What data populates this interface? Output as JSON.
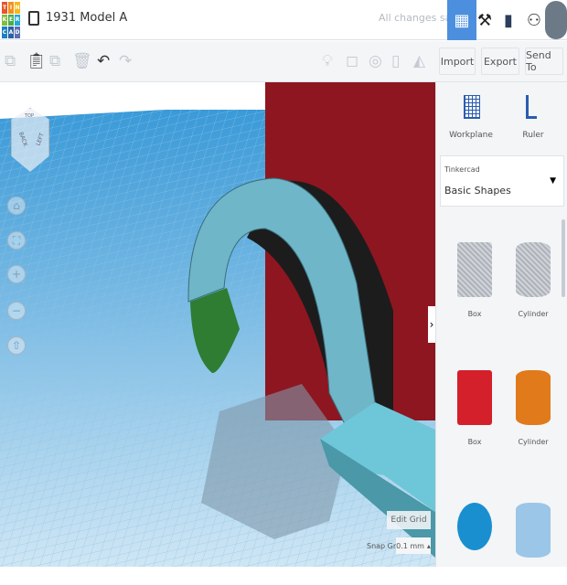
{
  "app": {
    "logo_letters": [
      "T",
      "I",
      "N",
      "K",
      "E",
      "R",
      "C",
      "A",
      "D"
    ],
    "logo_colors": [
      "#e8562a",
      "#f29123",
      "#f5b91d",
      "#83bd3e",
      "#4aad4c",
      "#26a9d0",
      "#1b7fc3",
      "#2c5fa3",
      "#5b6fb3"
    ],
    "title": "1931 Model A",
    "status": "All changes saved",
    "accent": "#4b8fde"
  },
  "toolbar": {
    "import": "Import",
    "export": "Export",
    "send_to": "Send To"
  },
  "sidebar": {
    "workplane": "Workplane",
    "ruler": "Ruler",
    "library_source": "Tinkercad",
    "library_name": "Basic Shapes",
    "shapes": [
      {
        "label": "Box",
        "color": "#b8bcc4"
      },
      {
        "label": "Cylinder",
        "color": "#b8bcc4"
      },
      {
        "label": "Box",
        "color": "#d4202a"
      },
      {
        "label": "Cylinder",
        "color": "#e07a1a"
      },
      {
        "label": "",
        "color": "#1a8fd0"
      },
      {
        "label": "",
        "color": "#9cc6e8"
      }
    ]
  },
  "viewport": {
    "view_cube": {
      "top": "TOP",
      "back": "BACK",
      "left": "LEFT"
    },
    "edit_grid": "Edit Grid",
    "snap_grid_label": "Snap Grid",
    "snap_grid_value": "0.1 mm"
  }
}
